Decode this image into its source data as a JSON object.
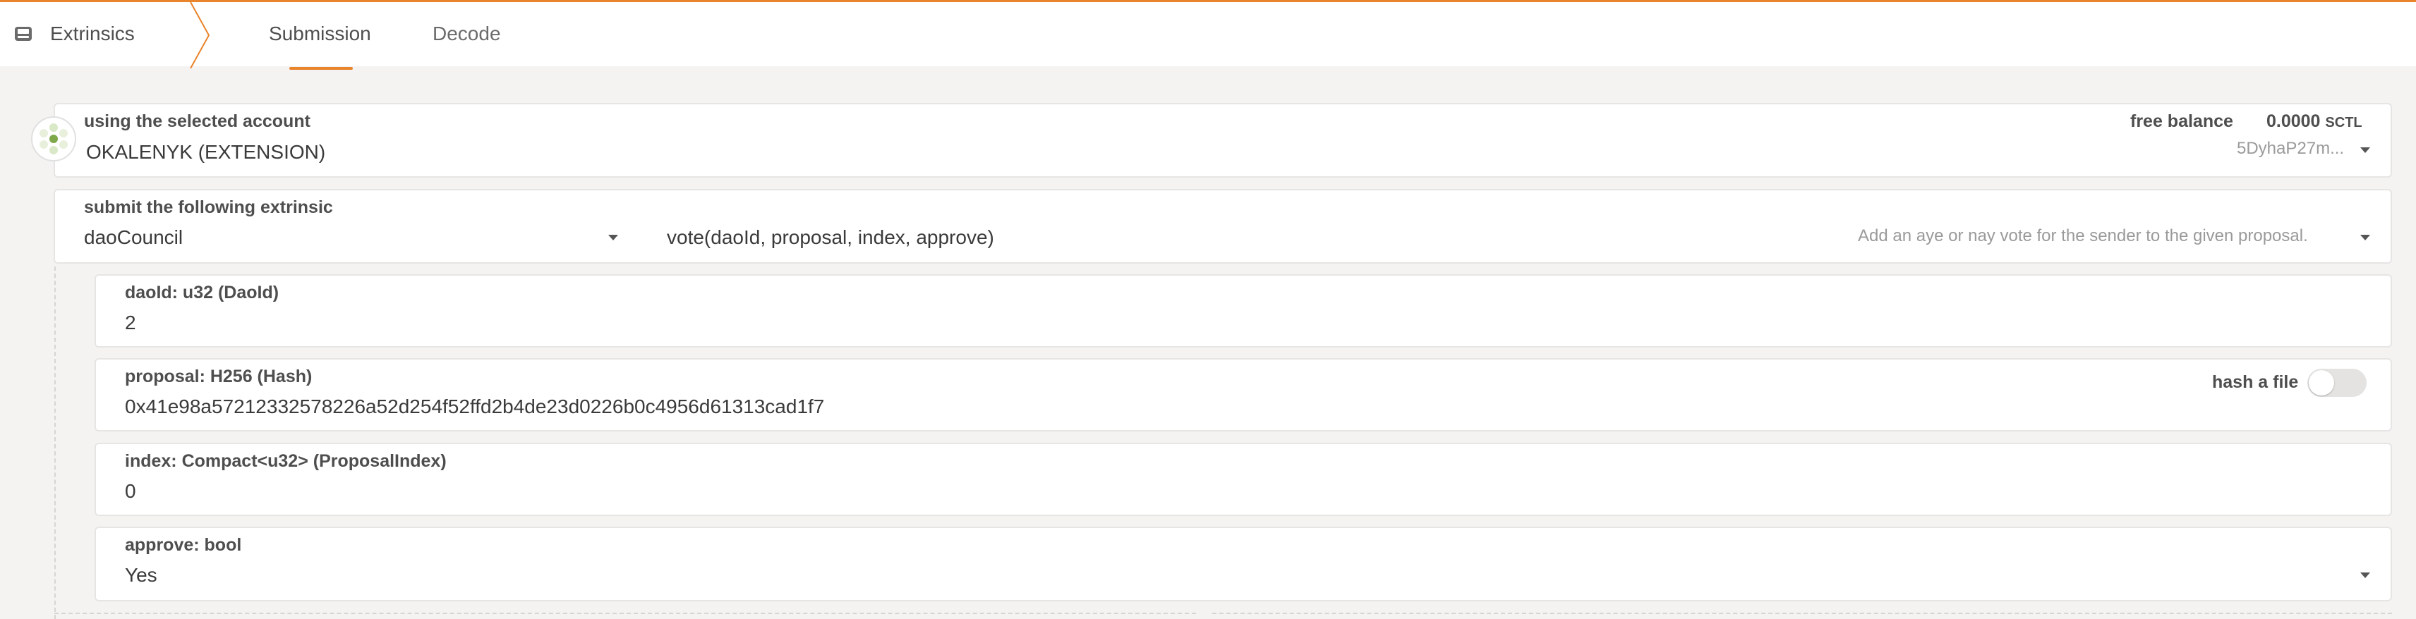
{
  "header": {
    "section_title": "Extrinsics",
    "section_icon": "inbox-icon",
    "tabs": [
      {
        "label": "Submission",
        "active": true
      },
      {
        "label": "Decode",
        "active": false
      }
    ],
    "accent_color": "#e8842c"
  },
  "account": {
    "label": "using the selected account",
    "name": "OKALENYK (EXTENSION)",
    "free_balance_label": "free balance",
    "balance_value": "0.0000",
    "balance_unit": "SCTL",
    "address": "5DyhaP27m..."
  },
  "extrinsic": {
    "label": "submit the following extrinsic",
    "module": "daoCouncil",
    "method": "vote(daoId, proposal, index, approve)",
    "description": "Add an aye or nay vote for the sender to the given proposal."
  },
  "params": [
    {
      "label": "daoId: u32 (DaoId)",
      "value": "2"
    },
    {
      "label": "proposal: H256 (Hash)",
      "value": "0x41e98a57212332578226a52d254f52ffd2b4de23d0226b0c4956d61313cad1f7",
      "hash_file_label": "hash a file"
    },
    {
      "label": "index: Compact<u32> (ProposalIndex)",
      "value": "0"
    },
    {
      "label": "approve: bool",
      "value": "Yes"
    }
  ]
}
